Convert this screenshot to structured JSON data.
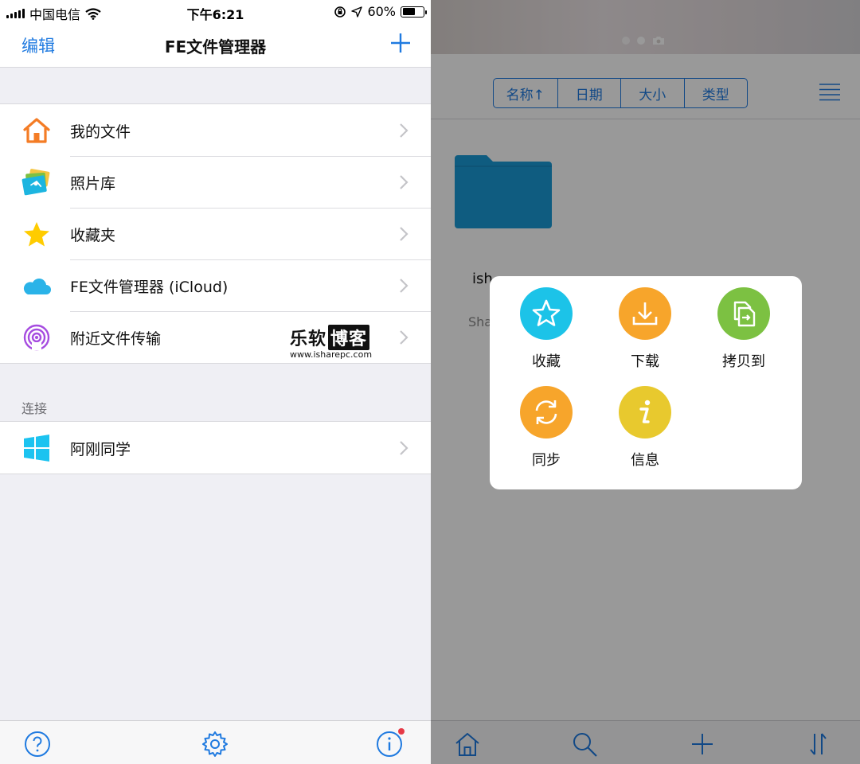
{
  "status_bar": {
    "carrier": "中国电信",
    "time": "下午6:21",
    "battery": "60%",
    "battery_level": 0.6
  },
  "nav": {
    "edit_label": "编辑",
    "title": "FE文件管理器"
  },
  "locations": {
    "items": [
      {
        "label": "我的文件",
        "icon": "home-icon"
      },
      {
        "label": "照片库",
        "icon": "photos-icon"
      },
      {
        "label": "收藏夹",
        "icon": "star-icon"
      },
      {
        "label": "FE文件管理器 (iCloud)",
        "icon": "cloud-icon"
      },
      {
        "label": "附近文件传输",
        "icon": "airdrop-icon"
      }
    ]
  },
  "connections": {
    "header": "连接",
    "items": [
      {
        "label": "阿刚同学",
        "icon": "windows-icon"
      }
    ]
  },
  "watermark": {
    "brand_a": "乐软",
    "brand_b": "博客",
    "url": "www.isharepc.com"
  },
  "sort_bar": {
    "options": [
      "名称↑",
      "日期",
      "大小",
      "类型"
    ]
  },
  "file": {
    "name_visible": "ish",
    "sub_visible": "Sha"
  },
  "action_sheet": {
    "actions": [
      {
        "label": "收藏",
        "icon": "star-outline-icon",
        "color": "#1cc3e8"
      },
      {
        "label": "下载",
        "icon": "download-icon",
        "color": "#f7a52b"
      },
      {
        "label": "拷贝到",
        "icon": "copy-to-icon",
        "color": "#7cc142"
      },
      {
        "label": "同步",
        "icon": "sync-icon",
        "color": "#f7a52b"
      },
      {
        "label": "信息",
        "icon": "info-italic-icon",
        "color": "#e8c92e"
      }
    ]
  },
  "colors": {
    "accent": "#1f7ae0",
    "folder": "#1a9ad6"
  }
}
